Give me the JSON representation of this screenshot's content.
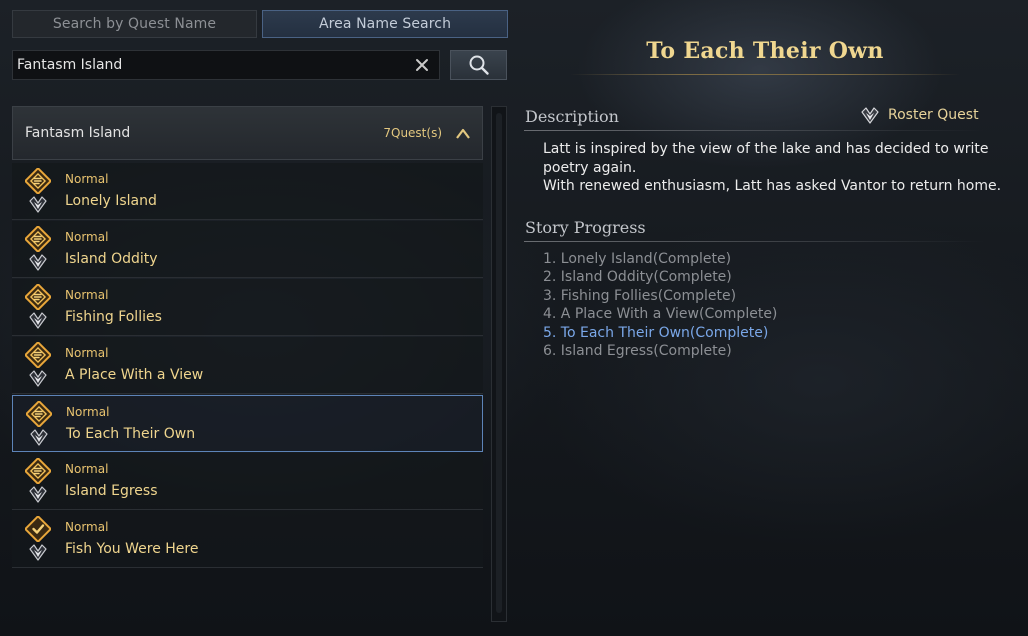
{
  "tabs": {
    "quest_name": "Search by Quest Name",
    "area_name": "Area Name Search"
  },
  "search": {
    "value": "Fantasm Island",
    "placeholder": ""
  },
  "group": {
    "name": "Fantasm Island",
    "count": "7Quest(s)"
  },
  "quests": [
    {
      "type": "Normal",
      "name": "Lonely Island",
      "icon": "quest-gold-scroll-icon"
    },
    {
      "type": "Normal",
      "name": "Island Oddity",
      "icon": "quest-gold-scroll-icon"
    },
    {
      "type": "Normal",
      "name": "Fishing Follies",
      "icon": "quest-gold-scroll-icon"
    },
    {
      "type": "Normal",
      "name": "A Place With a View",
      "icon": "quest-gold-scroll-icon"
    },
    {
      "type": "Normal",
      "name": "To Each Their Own",
      "icon": "quest-gold-scroll-icon",
      "selected": true
    },
    {
      "type": "Normal",
      "name": "Island Egress",
      "icon": "quest-gold-scroll-icon"
    },
    {
      "type": "Normal",
      "name": "Fish You Were Here",
      "icon": "quest-gold-check-icon"
    }
  ],
  "detail": {
    "title": "To Each Their Own",
    "description_heading": "Description",
    "roster_label": "Roster Quest",
    "description_lines": [
      "Latt is inspired by the view of the lake and has decided to write",
      "poetry again.",
      "With renewed enthusiasm, Latt has asked Vantor to return home."
    ],
    "story_heading": "Story Progress",
    "progress": [
      "1. Lonely Island(Complete)",
      "2. Island Oddity(Complete)",
      "3. Fishing Follies(Complete)",
      "4. A Place With a View(Complete)",
      "5. To Each Their Own(Complete)",
      "6. Island Egress(Complete)"
    ],
    "current_progress_index": 4
  },
  "colors": {
    "gold_text": "#efd58e",
    "selected_border": "#5d84b8",
    "current_progress": "#7aa7e8"
  }
}
